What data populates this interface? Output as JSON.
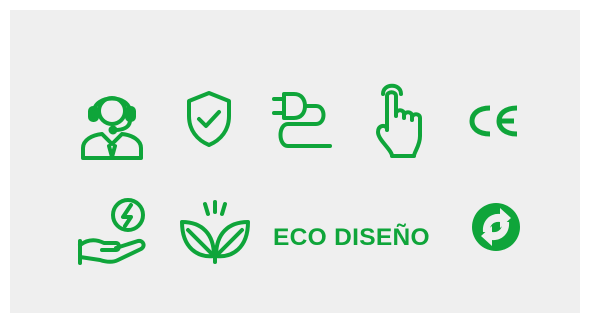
{
  "colors": {
    "panel_background": "#efefef",
    "page_background": "#ffffff",
    "icon_green": "#0fa53a"
  },
  "icons": [
    "customer-support-headset-icon",
    "shield-check-icon",
    "power-plug-cable-icon",
    "touch-hand-icon",
    "ce-mark-icon",
    "energy-saving-hand-icon",
    "eco-leaves-icon",
    "green-dot-recycling-icon"
  ],
  "eco_label": "ECO DISEÑO"
}
